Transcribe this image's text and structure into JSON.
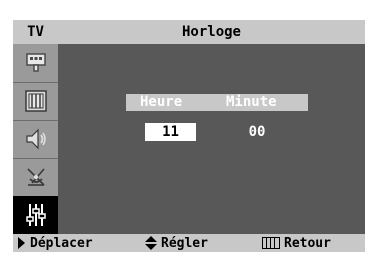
{
  "header": {
    "tv_label": "TV",
    "title": "Horloge"
  },
  "sidebar": {
    "items": [
      {
        "icon": "input-icon",
        "selected": false
      },
      {
        "icon": "picture-icon",
        "selected": false
      },
      {
        "icon": "sound-icon",
        "selected": false
      },
      {
        "icon": "antenna-icon",
        "selected": false
      },
      {
        "icon": "setup-icon",
        "selected": true
      }
    ]
  },
  "clock": {
    "hour_label": "Heure",
    "minute_label": "Minute",
    "hour_value": "11",
    "minute_value": "00"
  },
  "footer": {
    "move_icon": "triangle-right-icon",
    "move_label": "Déplacer",
    "adjust_icon": "up-down-arrows-icon",
    "adjust_label": "Régler",
    "return_icon": "menu-icon",
    "return_label": "Retour"
  },
  "colors": {
    "panel": "#585858",
    "bar": "#c8c8c8",
    "sidebar": "#9a9a9a",
    "selected": "#000000"
  }
}
